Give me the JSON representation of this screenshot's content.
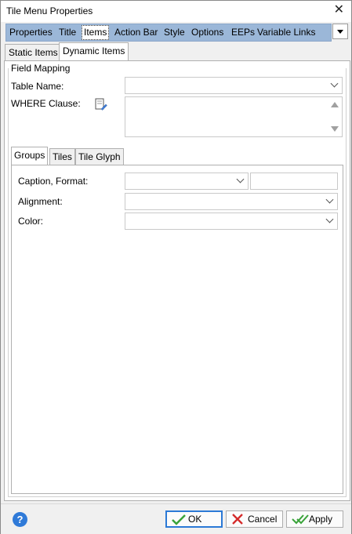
{
  "window": {
    "title": "Tile Menu Properties",
    "close_icon": "close-icon"
  },
  "main_tabs": [
    {
      "label": "Properties"
    },
    {
      "label": "Title"
    },
    {
      "label": "Items"
    },
    {
      "label": "Action Bar"
    },
    {
      "label": "Style"
    },
    {
      "label": "Options"
    },
    {
      "label": "EEPs"
    },
    {
      "label": "Variable Links"
    }
  ],
  "active_main_tab": "Items",
  "sub_tabs": [
    {
      "label": "Static Items"
    },
    {
      "label": "Dynamic Items"
    }
  ],
  "active_sub_tab": "Dynamic Items",
  "field_mapping": {
    "group_label": "Field Mapping",
    "table_name_label": "Table Name:",
    "table_name_value": "",
    "where_label": "WHERE Clause:",
    "where_value": ""
  },
  "inner_tabs": [
    {
      "label": "Groups"
    },
    {
      "label": "Tiles"
    },
    {
      "label": "Tile Glyph"
    }
  ],
  "active_inner_tab": "Groups",
  "groups": {
    "caption_format_label": "Caption, Format:",
    "caption_value": "",
    "format_value": "",
    "alignment_label": "Alignment:",
    "alignment_value": "",
    "color_label": "Color:",
    "color_value": ""
  },
  "footer": {
    "help_icon": "?",
    "ok_label": "OK",
    "cancel_label": "Cancel",
    "apply_label": "Apply"
  },
  "colors": {
    "tab_strip": "#9bb7d8",
    "accent_border": "#2b79d6",
    "ok_check": "#3aa33a",
    "cancel_x": "#d42a2a"
  }
}
